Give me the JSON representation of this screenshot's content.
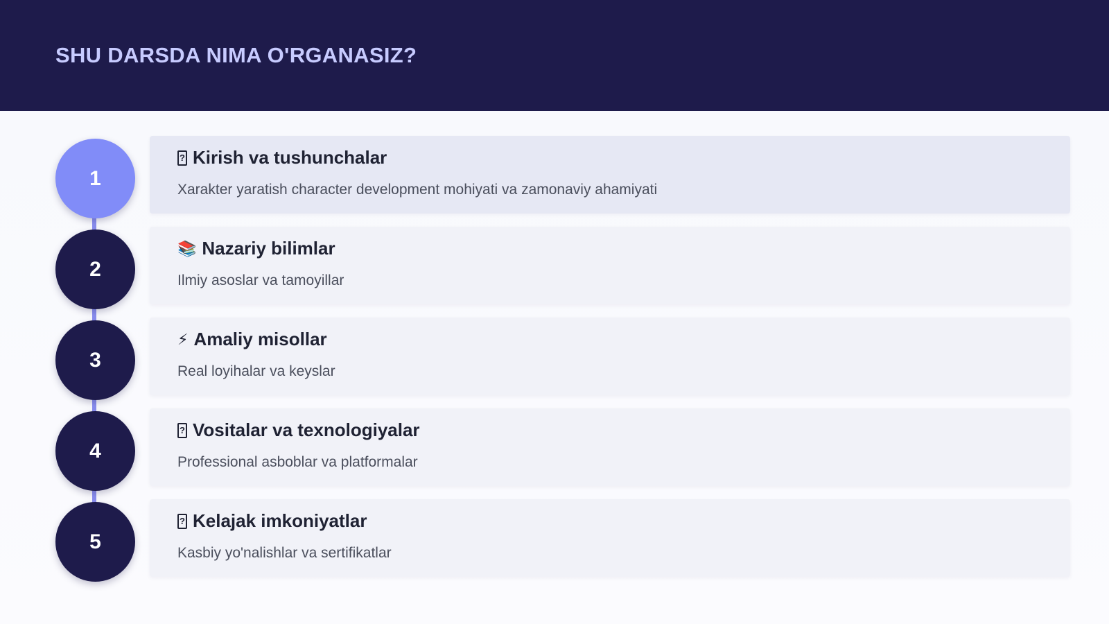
{
  "header": {
    "title": "SHU DARSDA NIMA O'RGANASIZ?"
  },
  "steps": [
    {
      "number": "1",
      "icon": "placeholder-glyph-icon",
      "icon_glyph": "?",
      "title": "Kirish va tushunchalar",
      "description": "Xarakter yaratish character development mohiyati va zamonaviy ahamiyati",
      "active": true
    },
    {
      "number": "2",
      "icon": "books-icon",
      "icon_glyph": "📚",
      "title": "Nazariy bilimlar",
      "description": "Ilmiy asoslar va tamoyillar",
      "active": false
    },
    {
      "number": "3",
      "icon": "lightning-icon",
      "icon_glyph": "⚡",
      "title": "Amaliy misollar",
      "description": "Real loyihalar va keyslar",
      "active": false
    },
    {
      "number": "4",
      "icon": "placeholder-glyph-icon",
      "icon_glyph": "?",
      "title": "Vositalar va texnologiyalar",
      "description": "Professional asboblar va platformalar",
      "active": false
    },
    {
      "number": "5",
      "icon": "placeholder-glyph-icon",
      "icon_glyph": "?",
      "title": "Kelajak imkoniyatlar",
      "description": "Kasbiy yo'nalishlar va sertifikatlar",
      "active": false
    }
  ],
  "colors": {
    "header_bg": "#1e1b4b",
    "header_text": "#c7cbff",
    "circle_default": "#1e1b4b",
    "circle_active": "#818cf8",
    "timeline": "#8b8ff0"
  }
}
